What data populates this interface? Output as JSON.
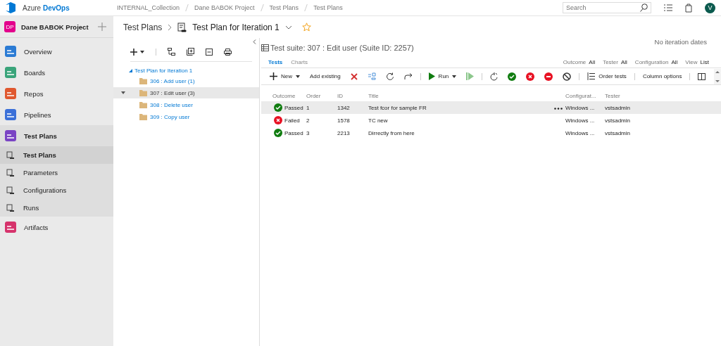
{
  "header": {
    "brand": "Azure",
    "product": "DevOps",
    "breadcrumbs": [
      "INTERNAL_Collection",
      "Dane BABOK Project",
      "Test Plans",
      "Test Plans"
    ],
    "search": {
      "placeholder": "Search"
    },
    "avatar": "V"
  },
  "project": {
    "badge": "DP",
    "name": "Dane BABOK Project"
  },
  "nav": [
    {
      "label": "Overview",
      "selected": false
    },
    {
      "label": "Boards",
      "selected": false
    },
    {
      "label": "Repos",
      "selected": false
    },
    {
      "label": "Pipelines",
      "selected": false
    },
    {
      "label": "Test Plans",
      "selected": true,
      "children": [
        {
          "label": "Test Plans",
          "selected": true
        },
        {
          "label": "Parameters",
          "selected": false
        },
        {
          "label": "Configurations",
          "selected": false
        },
        {
          "label": "Runs",
          "selected": false
        }
      ]
    },
    {
      "label": "Artifacts",
      "selected": false
    }
  ],
  "page": {
    "hub": "Test Plans",
    "plan": "Test Plan for Iteration 1",
    "dates": "No iteration dates"
  },
  "tree": {
    "label": "Test Plan for Iteration 1",
    "expanded": true,
    "children": [
      {
        "label": "306 : Add user (1)",
        "selected": false
      },
      {
        "label": "307 : Edit user (3)",
        "selected": true
      },
      {
        "label": "308 : Delete user",
        "selected": false
      },
      {
        "label": "309 : Copy user",
        "selected": false
      }
    ]
  },
  "suite": {
    "title": "Test suite: 307 : Edit user (Suite ID: 2257)"
  },
  "tabs": [
    {
      "label": "Tests",
      "selected": true
    },
    {
      "label": "Charts",
      "selected": false
    }
  ],
  "filters": [
    {
      "label": "Outcome",
      "value": "All"
    },
    {
      "label": "Tester",
      "value": "All"
    },
    {
      "label": "Configuration",
      "value": "All"
    },
    {
      "label": "View",
      "value": "List"
    }
  ],
  "toolbar": [
    {
      "kind": "menu",
      "label": "New"
    },
    {
      "kind": "text",
      "label": "Add existing"
    },
    {
      "kind": "icon"
    },
    {
      "kind": "icon"
    },
    {
      "kind": "icon"
    },
    {
      "kind": "icon"
    },
    {
      "kind": "sep"
    },
    {
      "kind": "menu",
      "label": "Run"
    },
    {
      "kind": "icon"
    },
    {
      "kind": "sep"
    },
    {
      "kind": "icon"
    },
    {
      "kind": "icon"
    },
    {
      "kind": "icon"
    },
    {
      "kind": "icon"
    },
    {
      "kind": "icon"
    },
    {
      "kind": "sep"
    },
    {
      "kind": "button",
      "label": "Order tests"
    },
    {
      "kind": "sep"
    },
    {
      "kind": "text",
      "label": "Column options"
    },
    {
      "kind": "sep"
    }
  ],
  "table": {
    "columns": [
      "Outcome",
      "Order",
      "ID",
      "Title",
      "Configurat...",
      "Tester"
    ],
    "rows": [
      {
        "outcome": "Passed",
        "kind": "pass",
        "order": "1",
        "id": "1342",
        "title": "Test fcor for sample FR",
        "config": "Windows ...",
        "tester": "vstsadmin",
        "selected": true
      },
      {
        "outcome": "Failed",
        "kind": "fail",
        "order": "2",
        "id": "1578",
        "title": "TC new",
        "config": "Windows ...",
        "tester": "vstsadmin",
        "selected": false
      },
      {
        "outcome": "Passed",
        "kind": "pass",
        "order": "3",
        "id": "2213",
        "title": "Dirrectly from here",
        "config": "Windows ...",
        "tester": "vstsadmin",
        "selected": false
      }
    ]
  }
}
